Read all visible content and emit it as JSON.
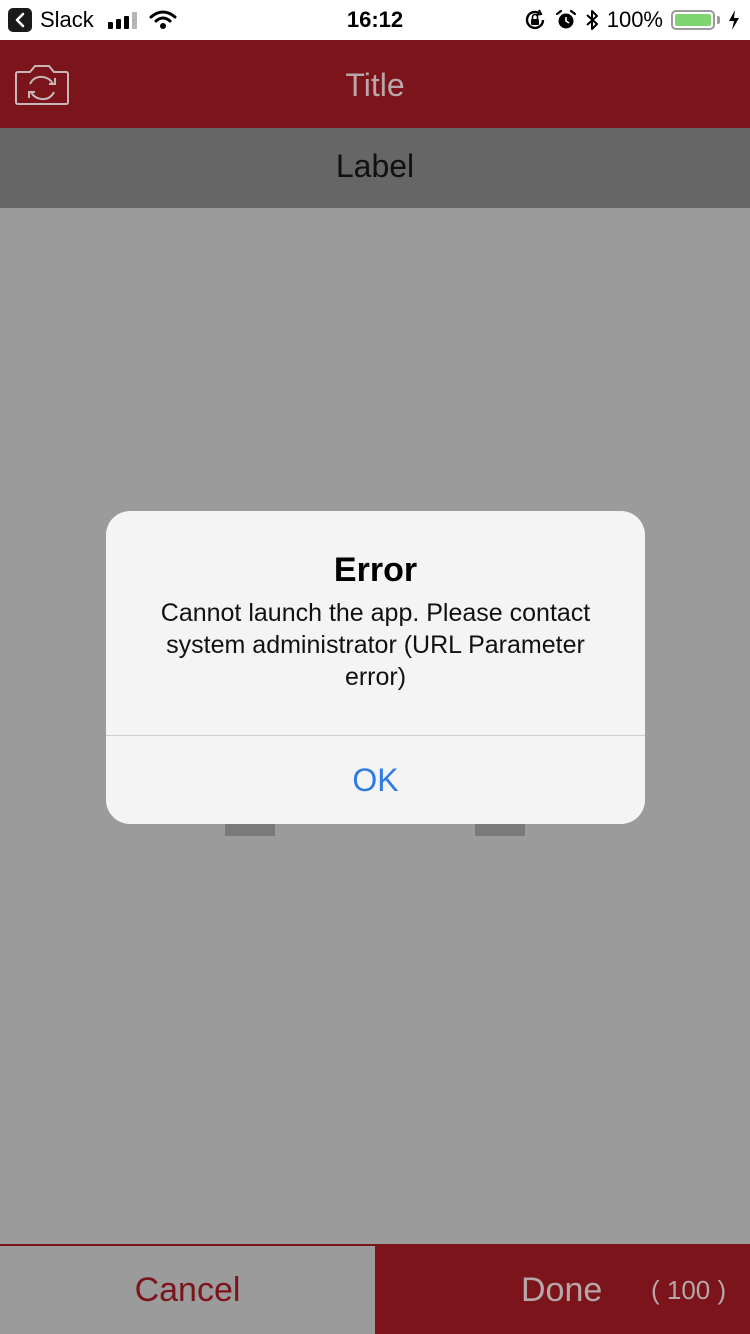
{
  "status_bar": {
    "back_app": "Slack",
    "time": "16:12",
    "battery_percent": "100%",
    "battery_level": 1.0,
    "icons": [
      "back-chevron-icon",
      "signal-bars-icon",
      "wifi-icon",
      "orientation-lock-icon",
      "alarm-icon",
      "bluetooth-icon",
      "battery-icon",
      "charging-bolt-icon"
    ]
  },
  "nav": {
    "title": "Title",
    "left_icon": "camera-switch-icon"
  },
  "label_bar": {
    "text": "Label"
  },
  "alert": {
    "title": "Error",
    "message": "Cannot launch the app. Please contact system administrator (URL Parameter error)",
    "button": "OK"
  },
  "bottom_bar": {
    "cancel": "Cancel",
    "done": "Done",
    "count": "( 100 )"
  },
  "colors": {
    "brand": "#7b141b",
    "nav_text": "#b7a7a8",
    "overlay_background": "#9b9b9b",
    "label_bar": "#666666",
    "alert_background": "#f4f4f4",
    "link_blue": "#2f7be6",
    "battery_green": "#7ed56f"
  }
}
